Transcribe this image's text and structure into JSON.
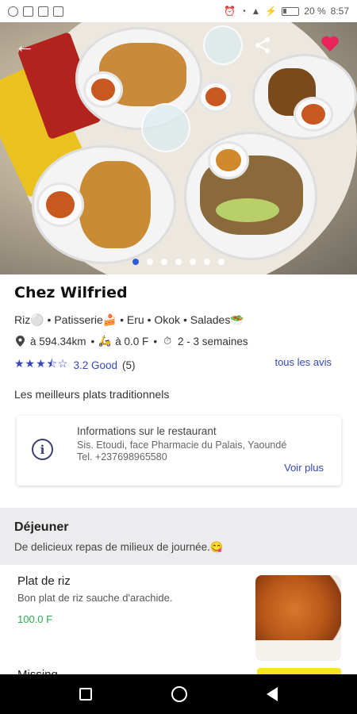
{
  "status_bar": {
    "battery": "20 %",
    "time": "8:57"
  },
  "restaurant": {
    "name": "Chez Wilfried",
    "categories": "Riz⚪ • Patisserie🍰 • Eru • Okok • Salades🥗",
    "distance": "à 594.34km",
    "delivery_fee": "à 0.0 F",
    "delivery_time": "2 - 3 semaines",
    "rating_stars": 3.5,
    "rating_text": "3.2 Good",
    "rating_count": "(5)",
    "all_reviews_label": "tous les avis",
    "tagline": "Les meilleurs plats traditionnels"
  },
  "gallery": {
    "total": 7,
    "active_index": 0
  },
  "info_card": {
    "title": "Informations sur le restaurant",
    "address": "Sis. Etoudi, face Pharmacie du Palais, Yaoundé",
    "phone": "Tel. +237698965580",
    "more_label": "Voir plus"
  },
  "section": {
    "title": "Déjeuner",
    "subtitle": "De delicieux repas de milieux de journée.😋"
  },
  "dishes": [
    {
      "name": "Plat de riz",
      "description": "Bon plat de riz sauche d'arachide.",
      "price": "100.0 F"
    },
    {
      "name": "Missing",
      "description": "",
      "price": ""
    }
  ],
  "colors": {
    "accent": "#3446b8",
    "price": "#2fa84f",
    "favorite": "#e8245b"
  }
}
